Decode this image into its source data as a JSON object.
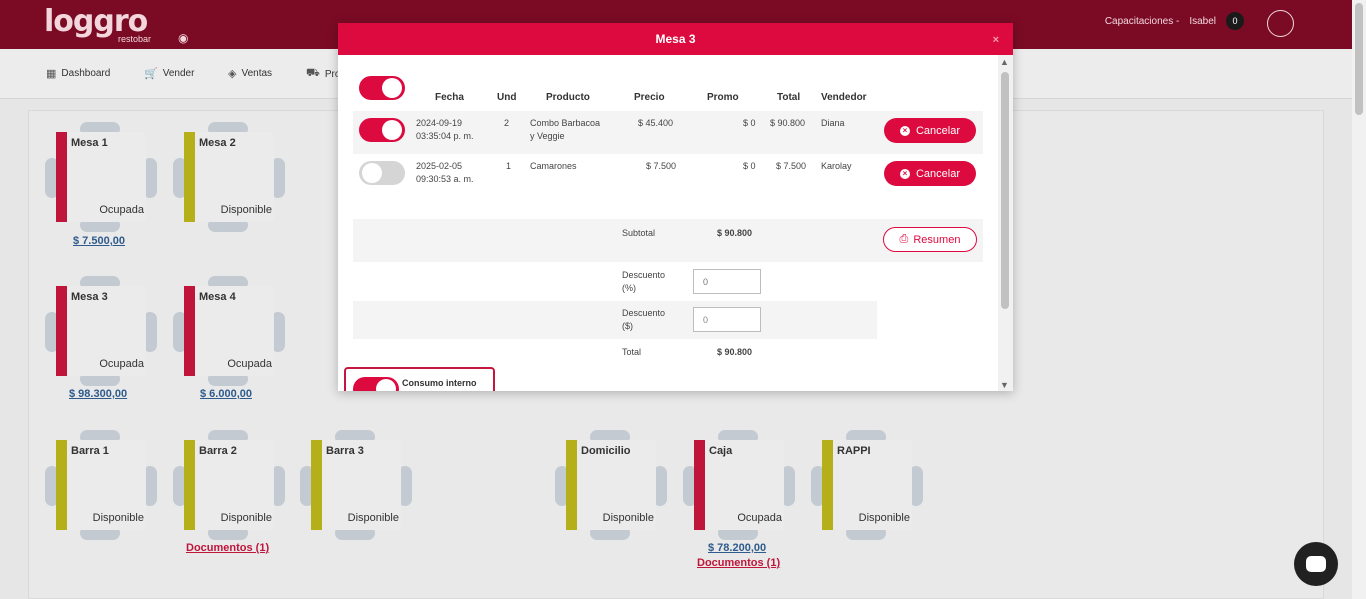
{
  "header": {
    "logo_text": "loggro",
    "logo_sub": "restobar",
    "user_prefix": "Capacitaciones -",
    "user_name": "Isabel",
    "notification_count": "0"
  },
  "nav": {
    "items": [
      {
        "label": "Dashboard"
      },
      {
        "label": "Vender"
      },
      {
        "label": "Ventas"
      },
      {
        "label": "Pro"
      }
    ]
  },
  "tables": [
    {
      "name": "Mesa 1",
      "status": "Ocupada",
      "color": "#c0153a",
      "amount": "$ 7.500,00"
    },
    {
      "name": "Mesa 2",
      "status": "Disponible",
      "color": "#b5b01a"
    },
    {
      "name": "Mesa 3",
      "status": "Ocupada",
      "color": "#c0153a",
      "amount": "$ 98.300,00"
    },
    {
      "name": "Mesa 4",
      "status": "Ocupada",
      "color": "#c0153a",
      "amount": "$ 6.000,00"
    },
    {
      "name": "Barra 1",
      "status": "Disponible",
      "color": "#b5b01a"
    },
    {
      "name": "Barra 2",
      "status": "Disponible",
      "color": "#b5b01a",
      "docs": "Documentos (1)"
    },
    {
      "name": "Barra 3",
      "status": "Disponible",
      "color": "#b5b01a"
    },
    {
      "name": "Domicilio",
      "status": "Disponible",
      "color": "#b5b01a"
    },
    {
      "name": "Caja",
      "status": "Ocupada",
      "color": "#c0153a",
      "amount": "$ 78.200,00",
      "docs": "Documentos (1)"
    },
    {
      "name": "RAPPI",
      "status": "Disponible",
      "color": "#b5b01a"
    }
  ],
  "modal": {
    "title": "Mesa 3",
    "close_label": "×",
    "columns": {
      "fecha": "Fecha",
      "und": "Und",
      "producto": "Producto",
      "precio": "Precio",
      "promo": "Promo",
      "total": "Total",
      "vendedor": "Vendedor"
    },
    "rows": [
      {
        "fecha_1": "2024-09-19",
        "fecha_2": "03:35:04 p. m.",
        "und": "2",
        "producto_1": "Combo Barbacoa",
        "producto_2": "y Veggie",
        "precio": "$ 45.400",
        "promo": "$ 0",
        "total": "$ 90.800",
        "vendedor": "Diana",
        "cancel_label": "Cancelar"
      },
      {
        "fecha_1": "2025-02-05",
        "fecha_2": "09:30:53 a. m.",
        "und": "1",
        "producto_1": "Camarones",
        "producto_2": "",
        "precio": "$ 7.500",
        "promo": "$ 0",
        "total": "$ 7.500",
        "vendedor": "Karolay",
        "cancel_label": "Cancelar"
      }
    ],
    "subtotal_label": "Subtotal",
    "subtotal_value": "$ 90.800",
    "resumen_label": "Resumen",
    "descuento_pct_label_1": "Descuento",
    "descuento_pct_label_2": "(%)",
    "descuento_pct_value": "0",
    "descuento_abs_label_1": "Descuento",
    "descuento_abs_label_2": "($)",
    "descuento_abs_value": "0",
    "total_label": "Total",
    "total_value": "$ 90.800",
    "consumo_label": "Consumo interno"
  },
  "colors": {
    "brand": "#dc0a3f",
    "topbar": "#7b0b25",
    "occupied": "#c0153a",
    "available": "#b5b01a"
  }
}
